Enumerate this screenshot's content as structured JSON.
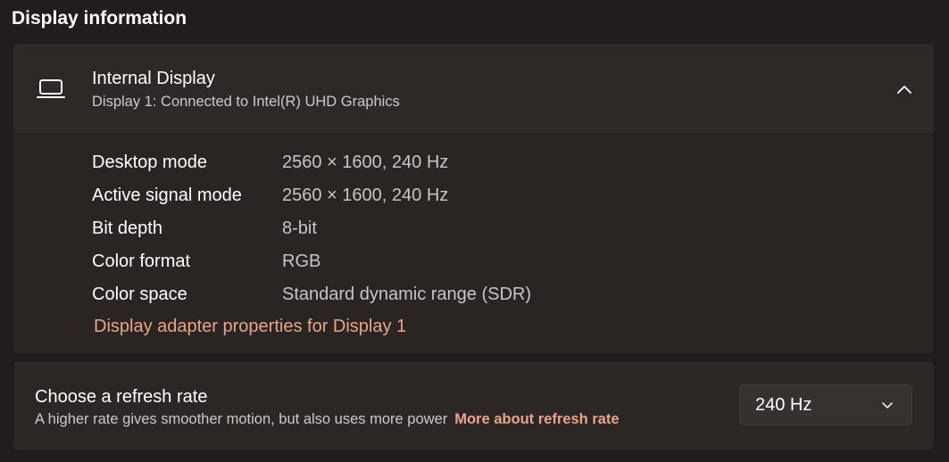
{
  "section": {
    "title": "Display information"
  },
  "display": {
    "icon": "laptop-icon",
    "name": "Internal Display",
    "subtitle": "Display 1: Connected to Intel(R) UHD Graphics",
    "expanded": true,
    "details": [
      {
        "label": "Desktop mode",
        "value": "2560 × 1600, 240 Hz"
      },
      {
        "label": "Active signal mode",
        "value": "2560 × 1600, 240 Hz"
      },
      {
        "label": "Bit depth",
        "value": "8-bit"
      },
      {
        "label": "Color format",
        "value": "RGB"
      },
      {
        "label": "Color space",
        "value": "Standard dynamic range (SDR)"
      }
    ],
    "adapter_link": "Display adapter properties for Display 1"
  },
  "refresh": {
    "title": "Choose a refresh rate",
    "description": "A higher rate gives smoother motion, but also uses more power",
    "link": "More about refresh rate",
    "selected": "240 Hz"
  },
  "colors": {
    "background": "#221d1c",
    "card": "#2b2524",
    "accent_link": "#e8a589",
    "secondary_text": "#c9c5c4"
  }
}
